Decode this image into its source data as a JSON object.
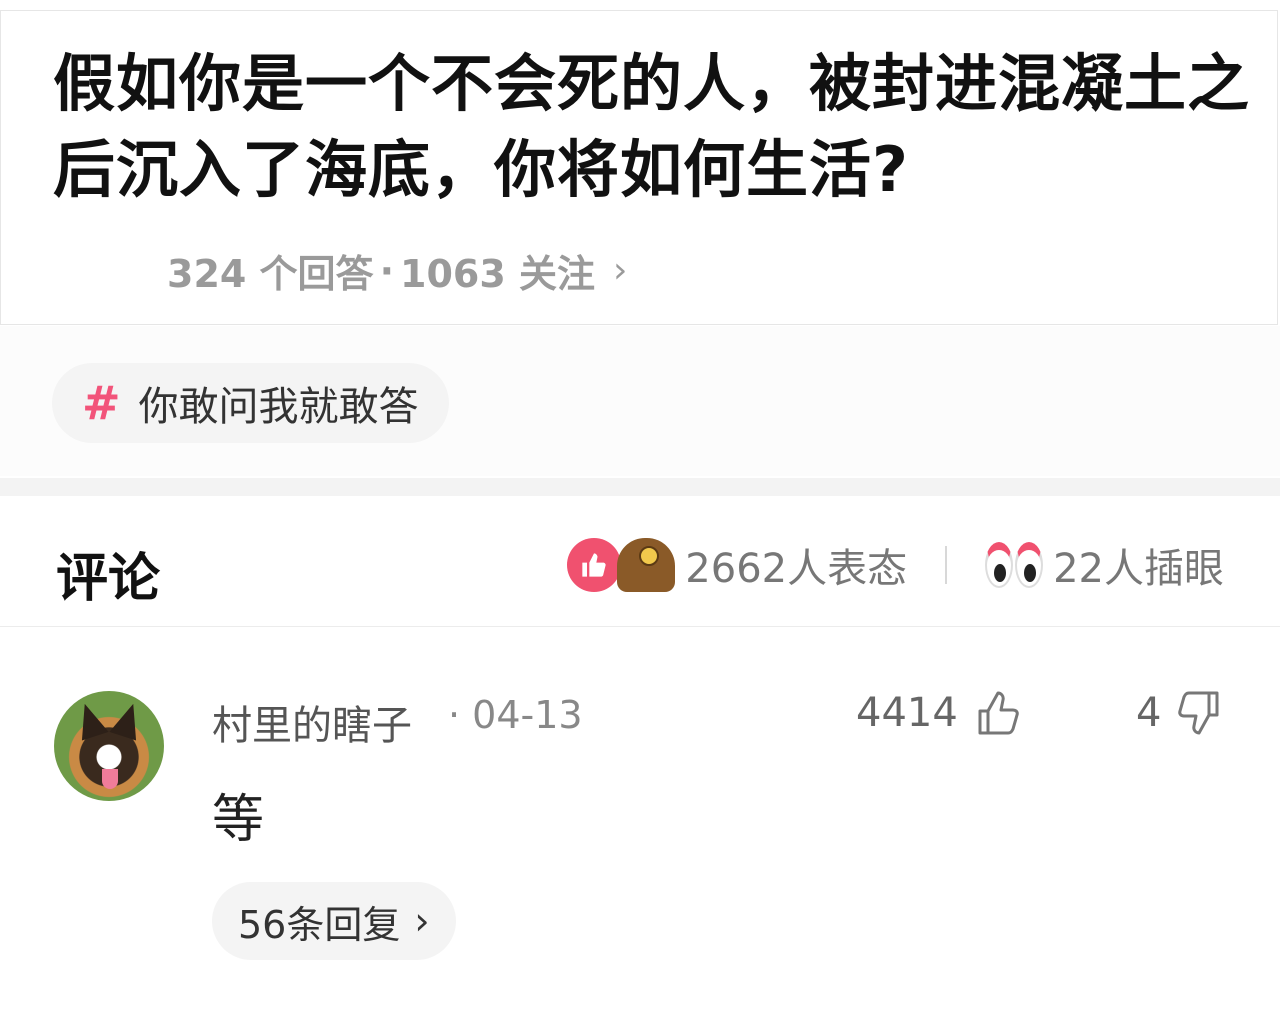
{
  "question": {
    "title": "假如你是一个不会死的人，被封进混凝土之后沉入了海底，你将如何生活?",
    "answers_count": "324 个回答",
    "dot": "·",
    "follow_count": "1063 关注",
    "chevron": "›"
  },
  "topic": {
    "hash": "#",
    "label": "你敢问我就敢答"
  },
  "comments_section": {
    "title": "评论",
    "reaction_text": "2662人表态",
    "peek_text": "22人插眼"
  },
  "comment": {
    "user": "村里的瞎子",
    "date": "· 04-13",
    "likes": "4414",
    "dislikes": "4",
    "text": "等",
    "replies_label": "56条回复",
    "replies_chevron": "›"
  },
  "colors": {
    "accent_pink": "#f0516f",
    "topic_hash": "#f2547a"
  }
}
